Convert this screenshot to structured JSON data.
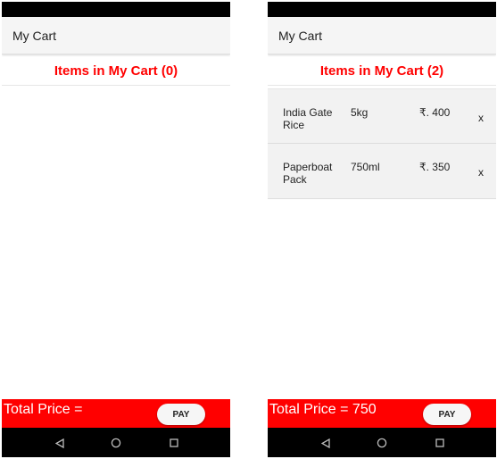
{
  "screens": [
    {
      "app_bar": {
        "title": "My Cart"
      },
      "cart_header": "Items in My Cart (0)",
      "items": [],
      "total_label": "Total Price = ",
      "pay_label": "PAY"
    },
    {
      "app_bar": {
        "title": "My Cart"
      },
      "cart_header": "Items in My Cart (2)",
      "items": [
        {
          "name": "India Gate Rice",
          "qty": "5kg",
          "price": "₹. 400",
          "remove": "x"
        },
        {
          "name": "Paperboat Pack",
          "qty": "750ml",
          "price": "₹. 350",
          "remove": "x"
        }
      ],
      "total_label": "Total Price = 750",
      "pay_label": "PAY"
    }
  ],
  "colors": {
    "accent": "#ff0000",
    "status_bar": "#000000",
    "app_bar": "#f5f5f5",
    "item_background": "#f2f2f2"
  },
  "icons": {
    "back": "triangle-back-icon",
    "home": "circle-home-icon",
    "recent": "square-recent-apps-icon"
  }
}
